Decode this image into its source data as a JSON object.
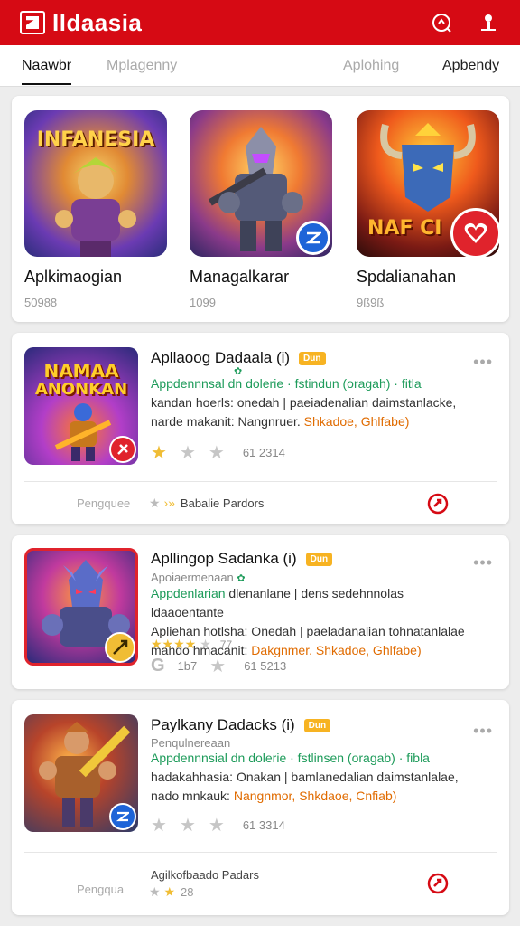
{
  "header": {
    "title": "Ildaasia",
    "colors": {
      "brand": "#d60a14"
    },
    "icons": [
      "logo-icon",
      "search-icon",
      "profile-icon"
    ]
  },
  "tabs": [
    {
      "label": "Naawbr",
      "active": true
    },
    {
      "label": "Mplagenny",
      "active": false
    },
    {
      "label": "Aplohing",
      "active": false
    },
    {
      "label": "Apbendy",
      "active": false
    }
  ],
  "featured": [
    {
      "name": "Aplkimaogian",
      "count": "50988",
      "art_text": "INFANESIA"
    },
    {
      "name": "Managalkarar",
      "count": "1099",
      "art_text": ""
    },
    {
      "name": "Spdalianahan",
      "count": "9ß9ß",
      "art_text": "NAF CI"
    }
  ],
  "apps": [
    {
      "title": "Apllaoog Dadaala (i)",
      "tag": "Dun",
      "art_text_1": "NAMAA",
      "art_text_2": "ANONKAN",
      "sub": "",
      "desc_1a": "Appdennnsal dn dolerie",
      "desc_1b": " · fstindun (oragah) · fitla",
      "desc_2": "kandan hoerls: onedah | paeiadenalian daimstanlacke,",
      "desc_3a": "narde makanit: Nangnruer. ",
      "desc_3b": "Shkadoe, Ghlfabe)",
      "rating_text": "61 2314",
      "footer_left": "Pengquee",
      "footer_mid": "Babalie Pardors"
    },
    {
      "title": "Apllingop Sadanka (i)",
      "tag": "Dun",
      "sub": "Apoiaermenaan",
      "desc_1a": "Appdenlarian",
      "desc_1b": " dlenanlane | dens sedehnnolas ldaaoentante",
      "desc_2": "Apliehan hotlsha: Onedah | paeladanalian tohnatanlalae",
      "desc_3a": "mahdo hmacanit: ",
      "desc_3b": "Dakgnmer. Shkadoe, Ghlfabe)",
      "rating_inline": "77",
      "rating_a": "1b7",
      "rating_text": "61 5213"
    },
    {
      "title": "Paylkany Dadacks (i)",
      "tag": "Dun",
      "sub": "Penqulnereaan",
      "desc_1a": "Appdennnsial dn dolerie",
      "desc_1b": " · fstlinsen (oragab) · fibla",
      "desc_2": "hadakahhasia: Onakan | bamlanedalian daimstanlalae,",
      "desc_3a": "nado mnkauk: ",
      "desc_3b": "Nangnmor, Shkdaoe, Cnfiab)",
      "rating_text": "61 3314",
      "footer_left": "Pengqua",
      "footer_mid": "Agilkofbaado Padars",
      "footer_rating": "28"
    }
  ]
}
